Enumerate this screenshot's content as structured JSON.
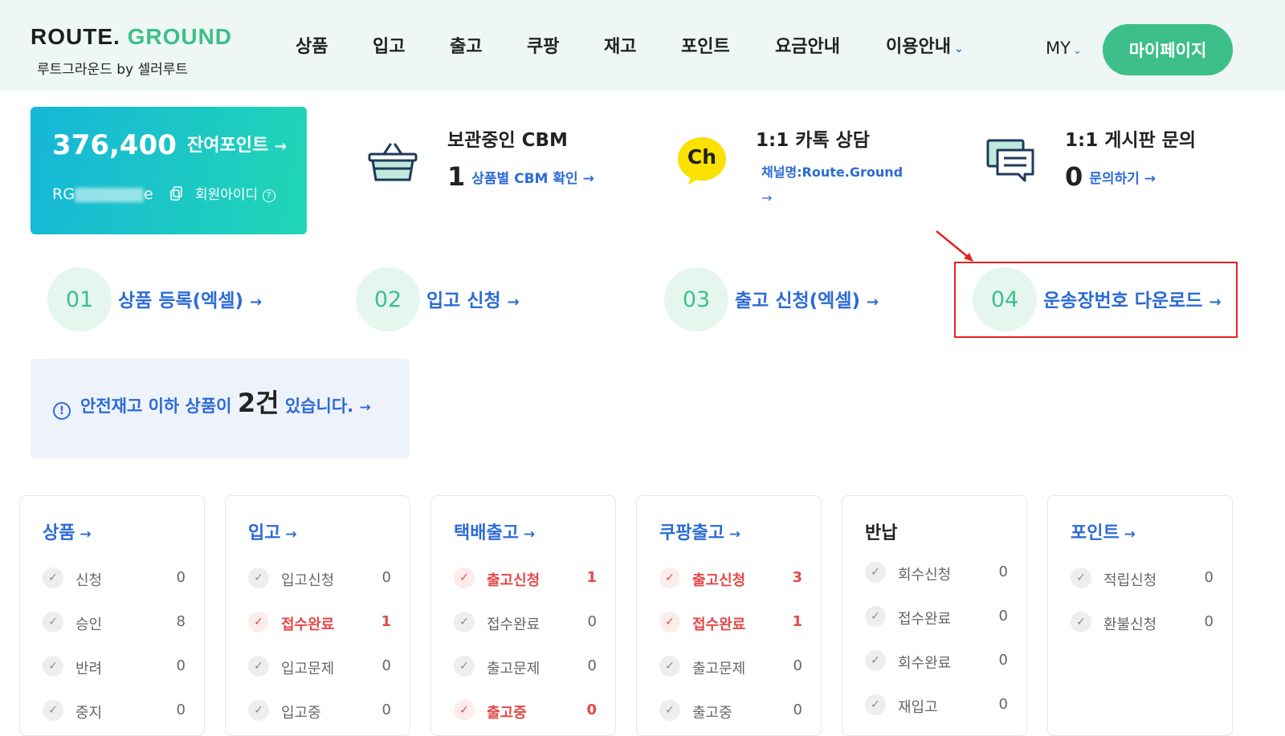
{
  "header": {
    "logo_left": "ROUTE. ",
    "logo_right": "GROUND",
    "logo_sub": "루트그라운드 by 셀러루트",
    "nav": [
      "상품",
      "입고",
      "출고",
      "쿠팡",
      "재고",
      "포인트",
      "요금안내",
      "이용안내"
    ],
    "my_label": "MY",
    "mypage_label": "마이페이지"
  },
  "points_card": {
    "value": "376,400",
    "link_label": "잔여포인트",
    "user_id_prefix": "RG",
    "user_id_suffix": "e",
    "member_label": "회원아이디"
  },
  "info": {
    "cbm_title": "보관중인 CBM",
    "cbm_count": "1",
    "cbm_link": "상품별 CBM 확인",
    "kakao_badge": "Ch",
    "kakao_title": "1:1 카톡 상담",
    "kakao_channel": "채널명:Route.Ground",
    "board_title": "1:1 게시판 문의",
    "board_count": "0",
    "board_link": "문의하기"
  },
  "steps": [
    {
      "num": "01",
      "label": "상품 등록(엑셀)"
    },
    {
      "num": "02",
      "label": "입고 신청"
    },
    {
      "num": "03",
      "label": "출고 신청(엑셀)"
    },
    {
      "num": "04",
      "label": "운송장번호 다운로드"
    }
  ],
  "alert": {
    "pre": "안전재고 이하 상품이",
    "count": "2건",
    "post": "있습니다."
  },
  "panels": [
    {
      "title": "상품",
      "rows": [
        {
          "label": "신청",
          "count": "0",
          "red": false
        },
        {
          "label": "승인",
          "count": "8",
          "red": false
        },
        {
          "label": "반려",
          "count": "0",
          "red": false
        },
        {
          "label": "중지",
          "count": "0",
          "red": false
        }
      ]
    },
    {
      "title": "입고",
      "rows": [
        {
          "label": "입고신청",
          "count": "0",
          "red": false
        },
        {
          "label": "접수완료",
          "count": "1",
          "red": true
        },
        {
          "label": "입고문제",
          "count": "0",
          "red": false
        },
        {
          "label": "입고중",
          "count": "0",
          "red": false
        }
      ]
    },
    {
      "title": "택배출고",
      "rows": [
        {
          "label": "출고신청",
          "count": "1",
          "red": true
        },
        {
          "label": "접수완료",
          "count": "0",
          "red": false
        },
        {
          "label": "출고문제",
          "count": "0",
          "red": false
        },
        {
          "label": "출고중",
          "count": "0",
          "red": true
        }
      ]
    },
    {
      "title": "쿠팡출고",
      "rows": [
        {
          "label": "출고신청",
          "count": "3",
          "red": true
        },
        {
          "label": "접수완료",
          "count": "1",
          "red": true
        },
        {
          "label": "출고문제",
          "count": "0",
          "red": false
        },
        {
          "label": "출고중",
          "count": "0",
          "red": false
        }
      ]
    },
    {
      "title": "반납",
      "rows": [
        {
          "label": "회수신청",
          "count": "0",
          "red": false
        },
        {
          "label": "접수완료",
          "count": "0",
          "red": false
        },
        {
          "label": "회수완료",
          "count": "0",
          "red": false
        },
        {
          "label": "재입고",
          "count": "0",
          "red": false
        }
      ]
    },
    {
      "title": "포인트",
      "rows": [
        {
          "label": "적립신청",
          "count": "0",
          "red": false
        },
        {
          "label": "환불신청",
          "count": "0",
          "red": false
        }
      ]
    }
  ]
}
